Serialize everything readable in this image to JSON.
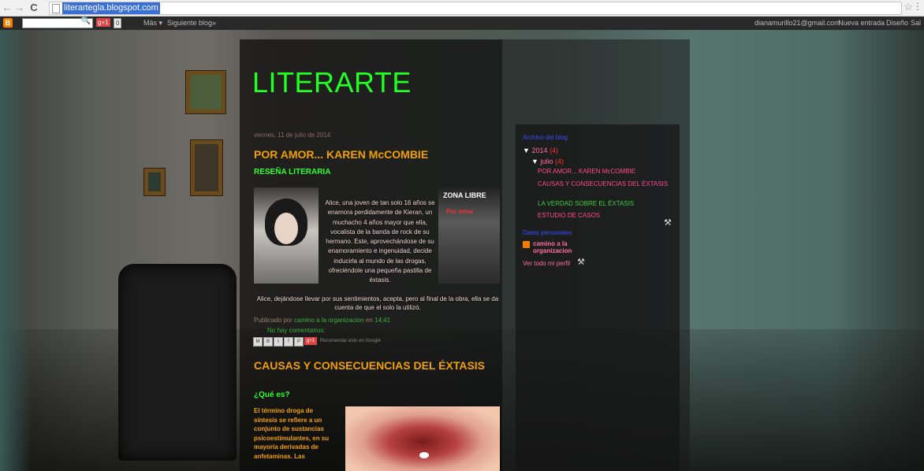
{
  "browser": {
    "url": "literartegla.blogspot.com",
    "back_glyph": "←",
    "forward_glyph": "→",
    "reload_glyph": "C",
    "star_glyph": "☆",
    "menu_glyph": "⋮"
  },
  "navbar": {
    "logo_glyph": "B",
    "search_glyph": "🔍",
    "gplus": "g+1",
    "gplus_count": "0",
    "more": "Más ▾",
    "next_blog": "Siguiente blog»",
    "email": "dianamurillo21@gmail.com",
    "new_post": "Nueva entrada",
    "design": "Diseño",
    "exit": "Sal"
  },
  "blog": {
    "title": "LITERARTE"
  },
  "post1": {
    "date": "viernes, 11 de julio de 2014",
    "title": "POR AMOR... KAREN McCOMBIE",
    "subheading": "RESEÑA LITERARIA",
    "book_cover_title": "ZONA LIBRE",
    "book_cover_subtitle": "Por amor",
    "text_side": "Alice, una joven de tan solo 16 años se enamora perdidamente de Kieran, un muchacho 4 años mayor que ella, vocalista de la banda de rock de su hermano. Este, aprovechándose de su enamoramiento e ingenuidad, decide inducirla al mundo de las drogas, ofreciéndole una pequeña pastilla de éxtasis.",
    "text_full": "Alice, dejándose llevar por sus sentimientos, acepta, pero al final de la obra, ella se da cuenta de que el solo la utilizó.",
    "published_by": "Publicado por",
    "author": "camino a la organizacion",
    "at": "en",
    "time": "14:41",
    "comments": "No hay comentarios:",
    "share_labels": [
      "M",
      "B",
      "t",
      "f",
      "P"
    ],
    "share_gplus": "g+1",
    "recommend": "Recomendar esto en Google"
  },
  "post2": {
    "title": "CAUSAS Y CONSECUENCIAS DEL ÉXTASIS",
    "question": "¿Qué es?",
    "text": "El término droga de síntesis se refiere a un conjunto de sustancias psicoestimulantes, en su mayoría derivadas de anfetaminas. Las"
  },
  "sidebar": {
    "archive_title": "Archivo del blog",
    "year": "2014",
    "year_count": "(4)",
    "month": "julio",
    "month_count": "(4)",
    "tri_down": "▼",
    "posts": [
      "POR AMOR... KAREN McCOMBIE",
      "CAUSAS Y CONSECUENCIAS DEL ÉXTASIS",
      "LA VERDAD SOBRE EL ÉXTASIS",
      "ESTUDIO DE CASOS"
    ],
    "wrench_glyph": "⚒",
    "profile_title": "Datos personales",
    "profile_name": "camino a la organizacion",
    "profile_link": "Ver todo mi perfil"
  }
}
